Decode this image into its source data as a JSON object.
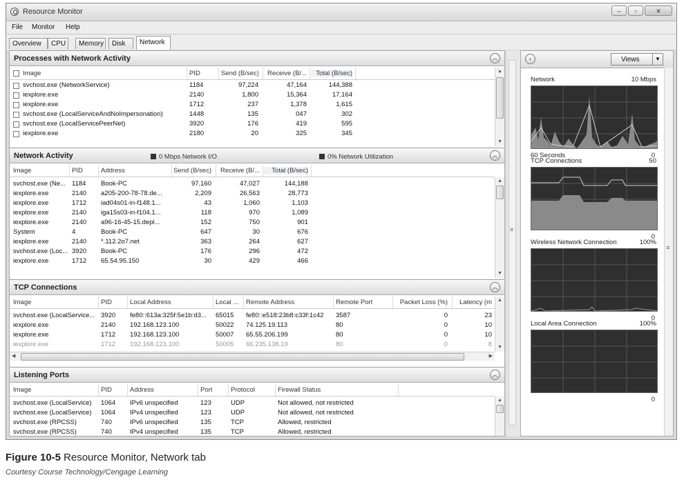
{
  "window": {
    "title": "Resource Monitor",
    "controls": [
      "–",
      "▫",
      "✕"
    ]
  },
  "menu": [
    "File",
    "Monitor",
    "Help"
  ],
  "tabs": [
    "Overview",
    "CPU",
    "Memory",
    "Disk",
    "Network"
  ],
  "processes": {
    "title": "Processes with Network Activity",
    "columns": [
      "Image",
      "PID",
      "Send (B/sec)",
      "Receive (B/...",
      "Total (B/sec)"
    ],
    "rows": [
      [
        "svchost.exe (NetworkService)",
        "1184",
        "97,224",
        "47,164",
        "144,388"
      ],
      [
        "iexplore.exe",
        "2140",
        "1,800",
        "15,364",
        "17,164"
      ],
      [
        "iexplore.exe",
        "1712",
        "237",
        "1,378",
        "1,615"
      ],
      [
        "svchost.exe (LocalServiceAndNoImpersonation)",
        "1448",
        "135",
        "047",
        "302"
      ],
      [
        "svchost.exe (LocalServicePeerNet)",
        "3920",
        "176",
        "419",
        "595"
      ],
      [
        "iexplore.exe",
        "2180",
        "20",
        "325",
        "345"
      ]
    ]
  },
  "network_activity": {
    "title": "Network Activity",
    "io_legend": "0 Mbps Network I/O",
    "util_legend": "0% Network Utilization",
    "columns": [
      "Image",
      "PID",
      "Address",
      "Send (B/sec)",
      "Receive (B/...",
      "Total (B/sec)"
    ],
    "rows": [
      [
        "svchost.exe (Ne...",
        "1184",
        "Book-PC",
        "97,160",
        "47,027",
        "144,188"
      ],
      [
        "iexplore.exe",
        "2140",
        "a205-200-78-78.de...",
        "2,209",
        "26,563",
        "28,773"
      ],
      [
        "iexplore.exe",
        "1712",
        "iad04s01-in-f148.1...",
        "43",
        "1,060",
        "1,103"
      ],
      [
        "iexplore.exe",
        "2140",
        "iga15s03-in-f104.1...",
        "118",
        "970",
        "1,089"
      ],
      [
        "iexplore.exe",
        "2140",
        "a96-16-45-15.depl...",
        "152",
        "750",
        "901"
      ],
      [
        "System",
        "4",
        "Book-PC",
        "647",
        "30",
        "676"
      ],
      [
        "iexplore.exe",
        "2140",
        "*.112.2o7.net",
        "363",
        "264",
        "627"
      ],
      [
        "svchost.exe (Loc...",
        "3920",
        "Book-PC",
        "176",
        "296",
        "472"
      ],
      [
        "iexplore.exe",
        "1712",
        "65.54.95.150",
        "30",
        "429",
        "466"
      ]
    ]
  },
  "tcp": {
    "title": "TCP Connections",
    "columns": [
      "Image",
      "PID",
      "Local Address",
      "Local ...",
      "Remote Address",
      "Remote Port",
      "Packet Loss (%)",
      "Latency (m"
    ],
    "rows": [
      [
        "svchost.exe (LocalService...",
        "3920",
        "fe80::613a:325f:5e1b:d3...",
        "65015",
        "fe80::e518:23b8:c33f:1c42",
        "3587",
        "0",
        "23"
      ],
      [
        "iexplore.exe",
        "2140",
        "192.168.123.100",
        "50022",
        "74.125.19.113",
        "80",
        "0",
        "10"
      ],
      [
        "iexplore.exe",
        "1712",
        "192.168.123.100",
        "50007",
        "65.55.206.199",
        "80",
        "0",
        "10"
      ],
      [
        "iexplore.exe",
        "1712",
        "192.168.123.100",
        "50005",
        "66.235.138.19",
        "80",
        "0",
        "8"
      ]
    ]
  },
  "listening": {
    "title": "Listening Ports",
    "columns": [
      "Image",
      "PID",
      "Address",
      "Port",
      "Protocol",
      "Firewall Status"
    ],
    "rows": [
      [
        "svchost.exe (LocalService)",
        "1064",
        "IPv6 unspecified",
        "123",
        "UDP",
        "Not allowed, not restricted"
      ],
      [
        "svchost.exe (LocalService)",
        "1064",
        "IPv4 unspecified",
        "123",
        "UDP",
        "Not allowed, not restricted"
      ],
      [
        "svchost.exe (RPCSS)",
        "740",
        "IPv6 unspecified",
        "135",
        "TCP",
        "Allowed, restricted"
      ],
      [
        "svchost.exe (RPCSS)",
        "740",
        "IPv4 unspecified",
        "135",
        "TCP",
        "Allowed, restricted"
      ]
    ]
  },
  "graphs": {
    "views_label": "Views",
    "items": [
      {
        "title": "Network",
        "scale": "10 Mbps",
        "left_label": "60 Seconds",
        "zero": "0"
      },
      {
        "title": "TCP Connections",
        "scale": "50",
        "zero": "0"
      },
      {
        "title": "Wireless Network Connection",
        "scale": "100%",
        "zero": "0"
      },
      {
        "title": "Local Area Connection",
        "scale": "100%",
        "zero": "0"
      }
    ]
  },
  "caption": {
    "figure": "Figure 10-5",
    "title": "Resource Monitor, Network tab",
    "credit": "Courtesy Course Technology/Cengage Learning"
  }
}
